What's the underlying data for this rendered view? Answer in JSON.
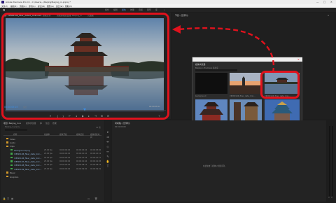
{
  "window": {
    "title": "Adobe Premiere Pro CC - C:\\Users\\...\\Beijing\\Beijing_in.prproj *",
    "minimize": "—",
    "maximize": "□",
    "close": "✕"
  },
  "menu": [
    "文件(F)",
    "编辑(E)",
    "剪辑(C)",
    "序列(S)",
    "标记(M)",
    "图形(G)",
    "窗口(W)",
    "帮助(H)"
  ],
  "workspaces": [
    "组件",
    "编辑",
    "颜色",
    "效果",
    "音频",
    "图形",
    "库",
    "»"
  ],
  "active_workspace_index": 2,
  "source_monitor": {
    "tabs": [
      "源: VIEW9196_fiber_detect_Unknown",
      "效果控件",
      "音频剪辑混合器: Beijing_in",
      "元数据"
    ],
    "timecode_left": "00:00:05:15",
    "fit_label": "适合",
    "timecode_right": "00:00:08:11"
  },
  "program_monitor": {
    "tab": "节目: (无序列)",
    "menu_icon": "≡"
  },
  "media_bin": {
    "title": "媒体浏览器",
    "path": "Beijing > Premiere 素材库",
    "close": "✕",
    "clips": [
      {
        "name": "background",
        "duration": "5:00"
      },
      {
        "name": "VIEW9196_fiber_date_Unk...",
        "duration": "10:11"
      },
      {
        "name": "VIEW9196_fiber_date_Unk...",
        "duration": "12:17"
      },
      {
        "name": "VIEW9197_fiber_date_Unk...",
        "duration": "12:05"
      },
      {
        "name": "VIEW9198_fiber_date_Unk...",
        "duration": "8:14"
      },
      {
        "name": "VIEW9199_fiber_date_Unk...",
        "duration": "9:21"
      }
    ]
  },
  "project_panel": {
    "tabs": [
      "项目: Beijing_in ≡",
      "媒体浏览器",
      "库",
      "信息",
      "效果"
    ],
    "path": "Beijing_in.prproj",
    "item_count": "12 项",
    "columns": [
      "名称",
      "帧速率",
      "媒体开始",
      "媒体结束",
      "媒体持续时间"
    ],
    "rows": [
      {
        "name": "Video",
        "indent": 1,
        "folder": true,
        "fps": "",
        "start": "",
        "end": "",
        "dur": ""
      },
      {
        "name": "Audio",
        "indent": 1,
        "folder": true,
        "fps": "",
        "start": "",
        "end": "",
        "dur": ""
      },
      {
        "name": "Clips",
        "indent": 1,
        "folder": true,
        "fps": "",
        "start": "",
        "end": "",
        "dur": ""
      },
      {
        "name": "background.png",
        "indent": 2,
        "folder": false,
        "fps": "25.00 fps",
        "start": "00:00:00:00",
        "end": "00:00:04:24",
        "dur": "00:00:05:00"
      },
      {
        "name": "VIEW9196_fiber_date_Unk...",
        "indent": 2,
        "folder": false,
        "fps": "25.00 fps",
        "start": "00:00:00:00",
        "end": "00:00:10:10",
        "dur": "00:00:10:11"
      },
      {
        "name": "VIEW9196_fiber_date_Unk...",
        "indent": 2,
        "folder": false,
        "fps": "25.00 fps",
        "start": "00:00:00:00",
        "end": "00:00:12:16",
        "dur": "00:00:12:17"
      },
      {
        "name": "VIEW9197_fiber_date_Unk...",
        "indent": 2,
        "folder": false,
        "fps": "25.00 fps",
        "start": "00:00:00:00",
        "end": "00:00:12:04",
        "dur": "00:00:12:05"
      },
      {
        "name": "VIEW9198_fiber_date_Unk...",
        "indent": 2,
        "folder": false,
        "fps": "25.00 fps",
        "start": "00:00:00:00",
        "end": "00:00:08:13",
        "dur": "00:00:08:14"
      },
      {
        "name": "VIEW9199_fiber_date_Unk...",
        "indent": 2,
        "folder": false,
        "fps": "25.00 fps",
        "start": "00:00:00:00",
        "end": "00:00:09:20",
        "dur": "00:00:09:21"
      },
      {
        "name": "Music",
        "indent": 1,
        "folder": true,
        "fps": "",
        "start": "",
        "end": "",
        "dur": ""
      },
      {
        "name": "Graphics",
        "indent": 1,
        "folder": true,
        "fps": "",
        "start": "",
        "end": "",
        "dur": ""
      }
    ]
  },
  "timeline": {
    "tab": "时间轴: (无序列)",
    "timecode": "00:00:00:00",
    "empty_message": "在此处放下媒体以创建序列。"
  },
  "colors": {
    "highlight": "#e0121d",
    "timecode": "#3d8fe8",
    "panel": "#232323"
  }
}
